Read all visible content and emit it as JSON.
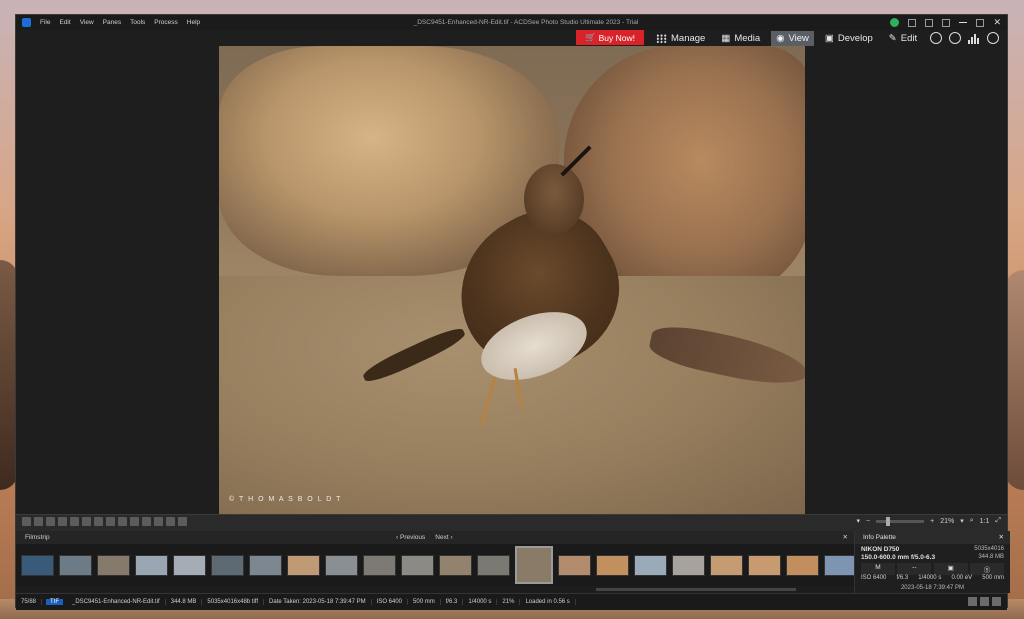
{
  "window": {
    "title": "_DSC9451-Enhanced-NR-Edit.tif - ACDSee Photo Studio Ultimate 2023 - Trial",
    "menu": [
      "File",
      "Edit",
      "View",
      "Panes",
      "Tools",
      "Process",
      "Help"
    ]
  },
  "modebar": {
    "buy_label": "Buy Now!",
    "modes": [
      {
        "label": "Manage",
        "icon": "grid-icon"
      },
      {
        "label": "Media",
        "icon": "media-icon"
      },
      {
        "label": "View",
        "icon": "eye-icon",
        "active": true
      },
      {
        "label": "Develop",
        "icon": "develop-icon"
      },
      {
        "label": "Edit",
        "icon": "edit-icon"
      }
    ]
  },
  "photo": {
    "credit": "© T H O M A S   B O L D T"
  },
  "toolbar": {
    "zoom": "21%",
    "ratio": "1:1"
  },
  "filmstrip": {
    "title": "Filmstrip",
    "prev": "Previous",
    "next": "Next",
    "thumbs": [
      "#3a5a7a",
      "#6c7b86",
      "#857a6c",
      "#9aa7b2",
      "#a4adb5",
      "#5d6a74",
      "#7c8792",
      "#c09a74",
      "#8a8f94",
      "#7d7a74",
      "#8c8a84",
      "#92826e",
      "#7a7a72",
      "#8a7a68",
      "#b28c6c",
      "#c28f5e",
      "#9aaab8",
      "#a7a39c",
      "#c49b72",
      "#c79a6f",
      "#c28e5f",
      "#7d95b0"
    ],
    "selected_index": 13
  },
  "info": {
    "title": "Info Palette",
    "camera": "NIKON D750",
    "lens": "150.0-600.0 mm f/5.0-6.3",
    "dimensions": "5035x4016",
    "filesize": "344.8 MB",
    "mode": "M",
    "iso": "ISO 6400",
    "aperture": "f/6.3",
    "shutter": "1/4000 s",
    "ev": "0.00 eV",
    "focal": "500 mm",
    "datetime": "2023-05-18 7:39:47 PM"
  },
  "status": {
    "counter": "75/88",
    "filetype": "TIF",
    "filename": "_DSC9451-Enhanced-NR-Edit.tif",
    "size": "344.8 MB",
    "dims": "5035x4016x48b tiff",
    "date": "Date Taken: 2023-05-18 7:39:47 PM",
    "iso": "ISO 6400",
    "focal": "500 mm",
    "aperture": "f/6.3",
    "shutter": "1/4000 s",
    "zoom": "21%",
    "loaded": "Loaded in 0.56 s"
  }
}
